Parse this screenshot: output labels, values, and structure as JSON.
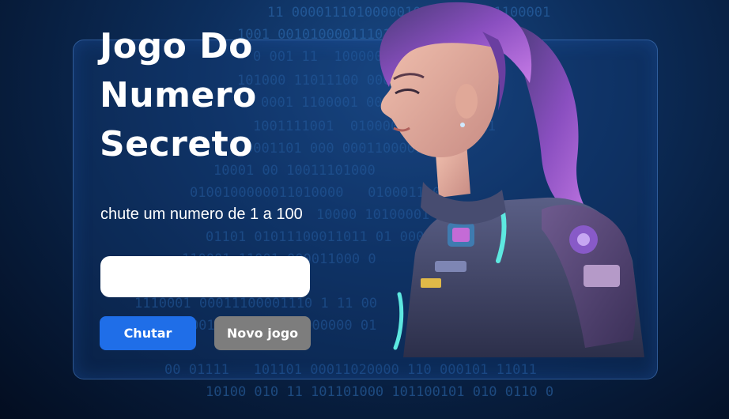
{
  "title": "Jogo Do\nNumero\nSecreto",
  "instruction": "chute um numero de 1 a 100",
  "guess_input": {
    "value": "",
    "placeholder": ""
  },
  "buttons": {
    "guess": "Chutar",
    "new_game": "Novo jogo"
  },
  "background_binary": [
    "11 00001110100000100001011101100001",
    "1001 00101000011101011100000 10",
    "0 001 11  1000001101 1 1 0",
    "101000 11011100 00011101000010  0",
    "0001 1100001 001 0000001 1",
    "1001111001  0100000 1 1 001011",
    "0001101 000 00011000010",
    "10001 00 10011101000",
    "0100100000011010000   0100011 00",
    "10000 10100001 010111",
    "01101 01011100011011 01 0001",
    "110001 11001 000011000 0",
    "1110001 00011100001110 1 11 00",
    "110000101111110000000000 01",
    "00 01111   101101 00011020000 110 000101 11011",
    "10100 010 11 101101000 101100101 010 0110 0"
  ],
  "colors": {
    "primary_button": "#1f6ee8",
    "secondary_button": "#7d7d7d",
    "background": "#0d2f5e"
  }
}
